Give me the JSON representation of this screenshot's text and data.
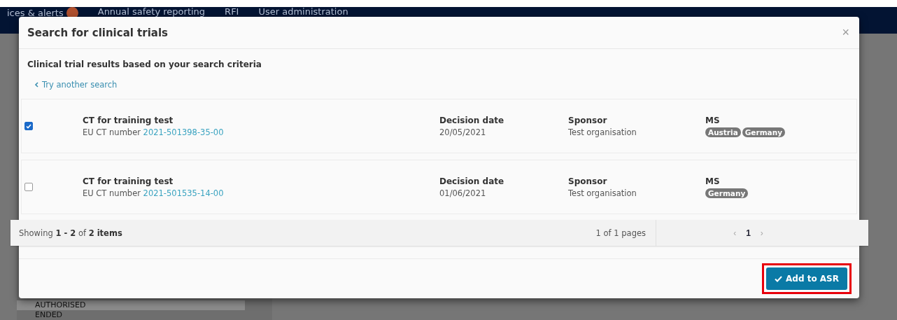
{
  "nav": {
    "items": [
      {
        "label": "ices & alerts",
        "badge": true
      },
      {
        "label": "Annual safety reporting",
        "badge": false
      },
      {
        "label": "RFI",
        "badge": false
      },
      {
        "label": "User administration",
        "badge": false
      }
    ]
  },
  "background": {
    "statuses": [
      "AUTHORISED",
      "ENDED"
    ]
  },
  "modal": {
    "title": "Search for clinical trials",
    "close": "×",
    "subtitle": "Clinical trial results based on your search criteria",
    "back_link": "Try another search",
    "results": [
      {
        "selected": true,
        "title": "CT for training test",
        "number_label": "EU CT number",
        "number": "2021-501398-35-00",
        "date_label": "Decision date",
        "date": "20/05/2021",
        "sponsor_label": "Sponsor",
        "sponsor": "Test organisation",
        "ms_label": "MS",
        "ms": [
          "Austria",
          "Germany"
        ]
      },
      {
        "selected": false,
        "title": "CT for training test",
        "number_label": "EU CT number",
        "number": "2021-501535-14-00",
        "date_label": "Decision date",
        "date": "01/06/2021",
        "sponsor_label": "Sponsor",
        "sponsor": "Test organisation",
        "ms_label": "MS",
        "ms": [
          "Germany"
        ]
      }
    ],
    "pager": {
      "summary": "Showing **1 - 2** of **2 items**",
      "pages": "1 of 1 pages",
      "prev": "‹",
      "page": "1",
      "next": "›"
    },
    "action": {
      "label": "Add to ASR",
      "highlighted": true
    }
  }
}
